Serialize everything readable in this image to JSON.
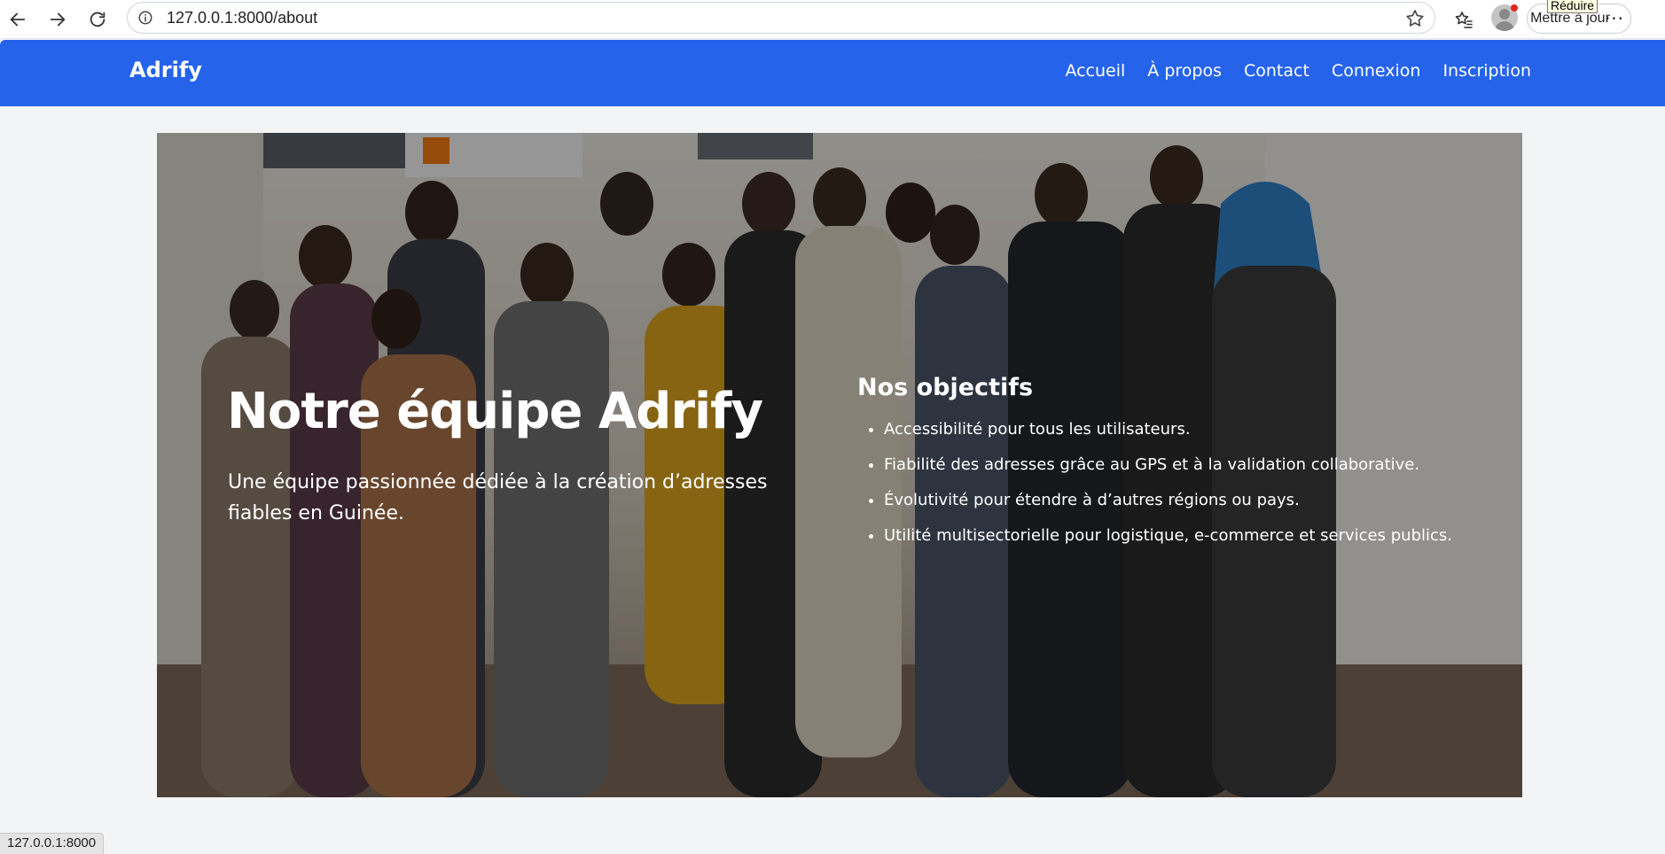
{
  "browser": {
    "url": "127.0.0.1:8000/about",
    "update_button_label": "Mettre à jour",
    "tooltip": "Réduire",
    "status_url": "127.0.0.1:8000"
  },
  "navbar": {
    "brand": "Adrify",
    "links": [
      {
        "label": "Accueil"
      },
      {
        "label": "À propos"
      },
      {
        "label": "Contact"
      },
      {
        "label": "Connexion"
      },
      {
        "label": "Inscription"
      }
    ]
  },
  "hero": {
    "title": "Notre équipe Adrify",
    "subtitle": "Une équipe passionnée dédiée à la création d’adresses fiables en Guinée.",
    "objectives_title": "Nos objectifs",
    "objectives": [
      "Accessibilité pour tous les utilisateurs.",
      "Fiabilité des adresses grâce au GPS et à la validation collaborative.",
      "Évolutivité pour étendre à d’autres régions ou pays.",
      "Utilité multisectorielle pour logistique, e-commerce et services publics."
    ]
  },
  "colors": {
    "navbar": "#2563eb",
    "page_background": "#f3f4f6"
  },
  "icons": {
    "back": "arrow-left-icon",
    "forward": "arrow-right-icon",
    "reload": "reload-icon",
    "site_info": "info-icon",
    "bookmark": "star-icon",
    "favorites": "favorites-icon",
    "profile": "profile-icon",
    "more": "more-icon"
  }
}
